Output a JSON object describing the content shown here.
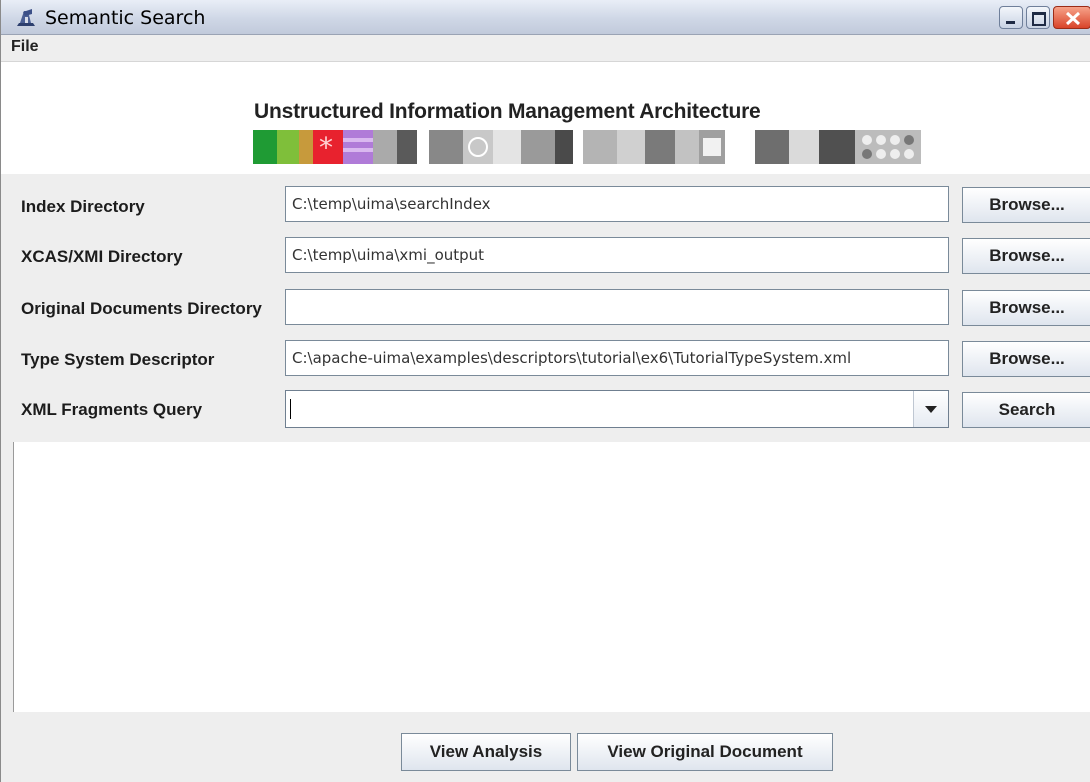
{
  "window": {
    "title": "Semantic Search"
  },
  "menu": {
    "items": [
      "File"
    ]
  },
  "banner": {
    "title": "Unstructured Information Management Architecture"
  },
  "form": {
    "rows": [
      {
        "label": "Index Directory",
        "value": "C:\\temp\\uima\\searchIndex",
        "button": "Browse..."
      },
      {
        "label": "XCAS/XMI Directory",
        "value": "C:\\temp\\uima\\xmi_output",
        "button": "Browse..."
      },
      {
        "label": "Original Documents Directory",
        "value": "",
        "button": "Browse..."
      },
      {
        "label": "Type System Descriptor",
        "value": "C:\\apache-uima\\examples\\descriptors\\tutorial\\ex6\\TutorialTypeSystem.xml",
        "button": "Browse..."
      }
    ],
    "query": {
      "label": "XML Fragments Query",
      "value": "",
      "button": "Search"
    }
  },
  "actions": {
    "view_analysis": "View Analysis",
    "view_original": "View Original Document"
  }
}
